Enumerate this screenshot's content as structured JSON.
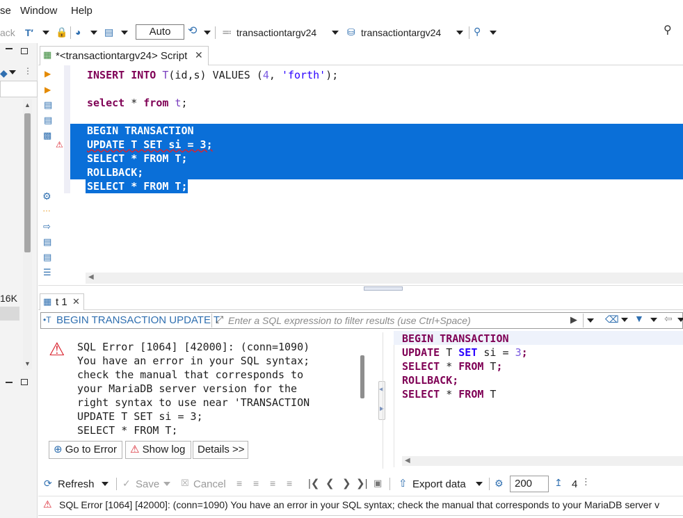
{
  "menu": {
    "items": [
      "se",
      "Window",
      "Help"
    ]
  },
  "toolbar": {
    "back_label": "ack",
    "transaction_mode": "Auto",
    "connection": "transactiontargv24",
    "database": "transactiontargv24"
  },
  "left_panel": {
    "size_label": "16K"
  },
  "editor": {
    "tab_title": "*<transactiontargv24> Script",
    "lines": {
      "insert": [
        "INSERT INTO ",
        "T",
        "(id,s) VALUES (",
        "4",
        ", ",
        "'forth'",
        ");"
      ],
      "select": [
        "select",
        " * ",
        "from",
        " ",
        "t",
        ";"
      ],
      "begin": "BEGIN TRANSACTION",
      "update": "UPDATE T SET si = 3;",
      "select_upper": "SELECT * FROM T;",
      "rollback": "ROLLBACK;",
      "select_upper2": "SELECT * FROM T;"
    }
  },
  "results": {
    "tab_label": "t 1",
    "query_label": "BEGIN TRANSACTION UPDATE T",
    "filter_placeholder": "Enter a SQL expression to filter results (use Ctrl+Space)",
    "error_message": "SQL Error [1064] [42000]: (conn=1090)\nYou have an error in your SQL syntax;\ncheck the manual that corresponds to\nyour MariaDB server version for the\nright syntax to use near 'TRANSACTION\nUPDATE T SET si = 3;\nSELECT * FROM T;",
    "buttons": {
      "go_to_error": "Go to Error",
      "show_log": "Show log",
      "details": "Details >>"
    },
    "sql_text": {
      "l1": "BEGIN TRANSACTION",
      "l2a": "UPDATE",
      "l2b": " T ",
      "l2c": "SET",
      "l2d": " si = ",
      "l2e": "3",
      "l2f": ";",
      "l3a": "SELECT",
      "l3b": " * ",
      "l3c": "FROM",
      "l3d": " T",
      "l3e": ";",
      "l4": "ROLLBACK",
      "l4b": ";",
      "l5a": "SELECT",
      "l5b": " * ",
      "l5c": "FROM",
      "l5d": " T"
    }
  },
  "bottom_toolbar": {
    "refresh": "Refresh",
    "save": "Save",
    "cancel": "Cancel",
    "export": "Export data",
    "fetch_size": "200",
    "row_count": "4"
  },
  "status": {
    "message": "SQL Error [1064] [42000]: (conn=1090) You have an error in your SQL syntax; check the manual that corresponds to your MariaDB server v"
  },
  "colors": {
    "selection": "#0a6fd8",
    "keyword": "#7f0055",
    "string": "#2a00ff",
    "error": "#d9232e"
  }
}
